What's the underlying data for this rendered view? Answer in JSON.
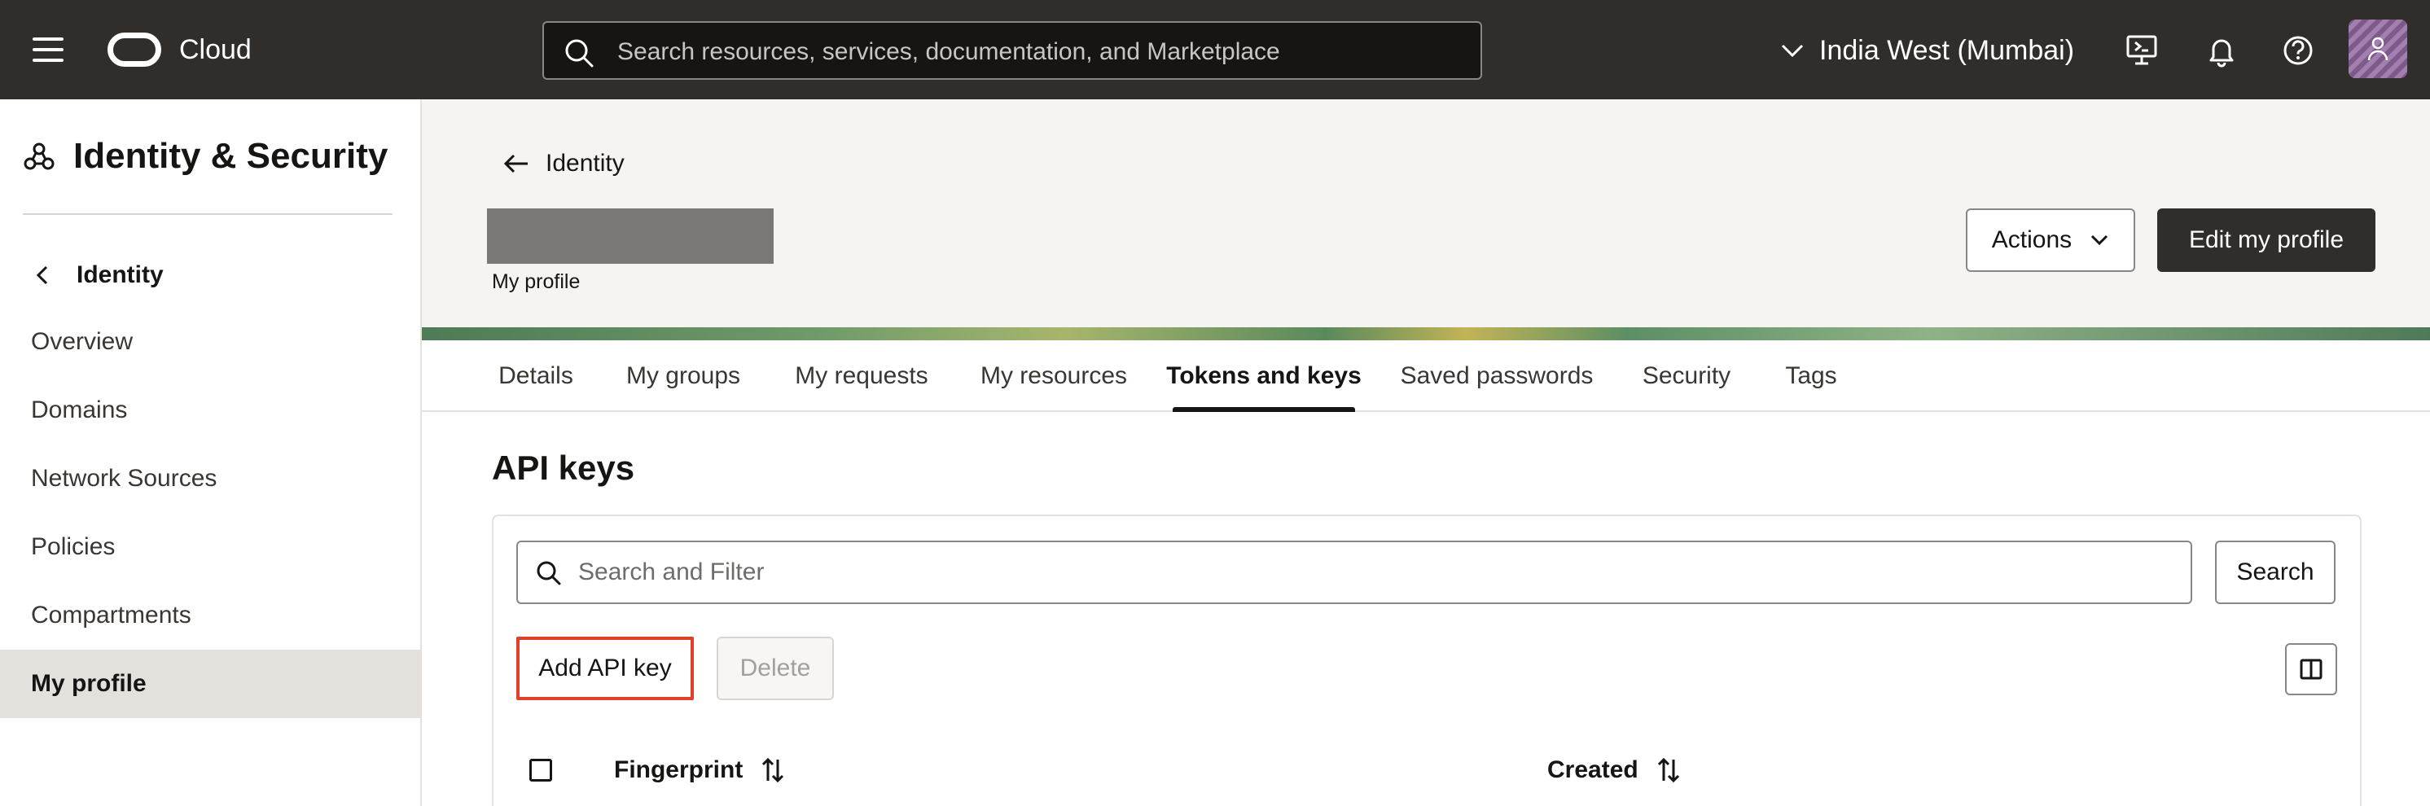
{
  "header": {
    "brand": "Cloud",
    "search_placeholder": "Search resources, services, documentation, and Marketplace",
    "region": "India West (Mumbai)"
  },
  "sidebar": {
    "title": "Identity & Security",
    "back_label": "Identity",
    "items": [
      {
        "label": "Overview"
      },
      {
        "label": "Domains"
      },
      {
        "label": "Network Sources"
      },
      {
        "label": "Policies"
      },
      {
        "label": "Compartments"
      },
      {
        "label": "My profile",
        "active": true
      }
    ]
  },
  "page": {
    "breadcrumb": "Identity",
    "subtitle": "My profile",
    "actions_label": "Actions",
    "edit_label": "Edit my profile"
  },
  "tabs": [
    {
      "label": "Details"
    },
    {
      "label": "My groups"
    },
    {
      "label": "My requests"
    },
    {
      "label": "My resources"
    },
    {
      "label": "Tokens and keys",
      "active": true
    },
    {
      "label": "Saved passwords"
    },
    {
      "label": "Security"
    },
    {
      "label": "Tags"
    }
  ],
  "api_keys": {
    "title": "API keys",
    "filter_placeholder": "Search and Filter",
    "search_label": "Search",
    "add_label": "Add API key",
    "delete_label": "Delete",
    "columns": [
      "Fingerprint",
      "Created"
    ]
  },
  "colors": {
    "header_bg": "#312d2a",
    "highlight": "#e0402a",
    "active_nav": "#e4e1dd"
  }
}
